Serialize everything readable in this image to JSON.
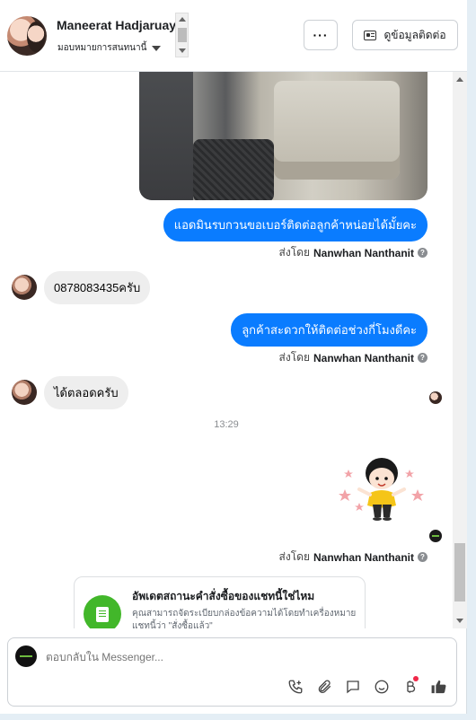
{
  "header": {
    "contact_name": "Maneerat Hadjaruay",
    "assign_label": "มอบหมายการสนทนานี้",
    "more_label": "···",
    "contact_info_label": "ดูข้อมูลติดต่อ"
  },
  "messages": {
    "out1": "แอดมินรบกวนขอเบอร์ติดต่อลูกค้าหน่อยได้มั้ยคะ",
    "sent_prefix": "ส่งโดย",
    "sender": "Nanwhan Nanthanit",
    "in1": "0878083435ครับ",
    "out2": "ลูกค้าสะดวกให้ติดต่อช่วงกี่โมงดีคะ",
    "in2": "ได้ตลอดครับ",
    "time": "13:29"
  },
  "card": {
    "title": "อัพเดตสถานะคำสั่งซื้อของแชทนี้ใช่ไหม",
    "description": "คุณสามารถจัดระเบียบกล่องข้อความได้โดยทำเครื่องหมายแชทนี้ว่า \"สั่งซื้อแล้ว\""
  },
  "composer": {
    "placeholder": "ตอบกลับใน Messenger..."
  },
  "colors": {
    "outgoing_bubble": "#0a7cff",
    "incoming_bubble": "#eeeeee",
    "card_icon": "#42b72a"
  },
  "icons": [
    "chevron-down-icon",
    "contact-card-icon",
    "help-icon",
    "call-icon",
    "attachment-icon",
    "saved-reply-icon",
    "emoji-icon",
    "baht-icon",
    "thumbs-up-icon"
  ]
}
